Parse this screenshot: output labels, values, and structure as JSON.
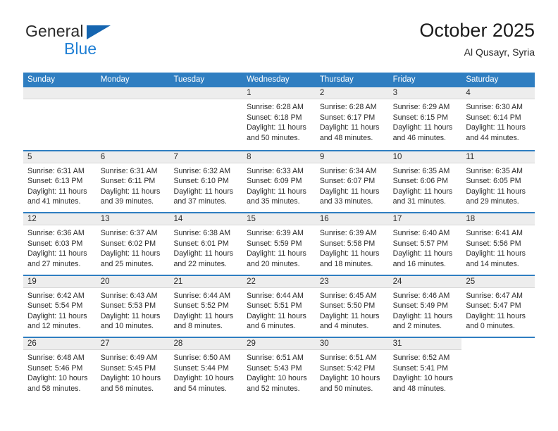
{
  "brand": {
    "name_part1": "General",
    "name_part2": "Blue",
    "triangle_color": "#1565b0",
    "blue_color": "#1f7fd4"
  },
  "header": {
    "title": "October 2025",
    "subtitle": "Al Qusayr, Syria"
  },
  "theme": {
    "header_blue": "#2f7ec1",
    "daynum_strip": "#ededed",
    "text": "#2a2a2a"
  },
  "weekdays": [
    "Sunday",
    "Monday",
    "Tuesday",
    "Wednesday",
    "Thursday",
    "Friday",
    "Saturday"
  ],
  "weeks": [
    [
      {
        "blank": true
      },
      {
        "blank": true
      },
      {
        "blank": true
      },
      {
        "day": "1",
        "sunrise": "Sunrise: 6:28 AM",
        "sunset": "Sunset: 6:18 PM",
        "daylight1": "Daylight: 11 hours",
        "daylight2": "and 50 minutes."
      },
      {
        "day": "2",
        "sunrise": "Sunrise: 6:28 AM",
        "sunset": "Sunset: 6:17 PM",
        "daylight1": "Daylight: 11 hours",
        "daylight2": "and 48 minutes."
      },
      {
        "day": "3",
        "sunrise": "Sunrise: 6:29 AM",
        "sunset": "Sunset: 6:15 PM",
        "daylight1": "Daylight: 11 hours",
        "daylight2": "and 46 minutes."
      },
      {
        "day": "4",
        "sunrise": "Sunrise: 6:30 AM",
        "sunset": "Sunset: 6:14 PM",
        "daylight1": "Daylight: 11 hours",
        "daylight2": "and 44 minutes."
      }
    ],
    [
      {
        "day": "5",
        "sunrise": "Sunrise: 6:31 AM",
        "sunset": "Sunset: 6:13 PM",
        "daylight1": "Daylight: 11 hours",
        "daylight2": "and 41 minutes."
      },
      {
        "day": "6",
        "sunrise": "Sunrise: 6:31 AM",
        "sunset": "Sunset: 6:11 PM",
        "daylight1": "Daylight: 11 hours",
        "daylight2": "and 39 minutes."
      },
      {
        "day": "7",
        "sunrise": "Sunrise: 6:32 AM",
        "sunset": "Sunset: 6:10 PM",
        "daylight1": "Daylight: 11 hours",
        "daylight2": "and 37 minutes."
      },
      {
        "day": "8",
        "sunrise": "Sunrise: 6:33 AM",
        "sunset": "Sunset: 6:09 PM",
        "daylight1": "Daylight: 11 hours",
        "daylight2": "and 35 minutes."
      },
      {
        "day": "9",
        "sunrise": "Sunrise: 6:34 AM",
        "sunset": "Sunset: 6:07 PM",
        "daylight1": "Daylight: 11 hours",
        "daylight2": "and 33 minutes."
      },
      {
        "day": "10",
        "sunrise": "Sunrise: 6:35 AM",
        "sunset": "Sunset: 6:06 PM",
        "daylight1": "Daylight: 11 hours",
        "daylight2": "and 31 minutes."
      },
      {
        "day": "11",
        "sunrise": "Sunrise: 6:35 AM",
        "sunset": "Sunset: 6:05 PM",
        "daylight1": "Daylight: 11 hours",
        "daylight2": "and 29 minutes."
      }
    ],
    [
      {
        "day": "12",
        "sunrise": "Sunrise: 6:36 AM",
        "sunset": "Sunset: 6:03 PM",
        "daylight1": "Daylight: 11 hours",
        "daylight2": "and 27 minutes."
      },
      {
        "day": "13",
        "sunrise": "Sunrise: 6:37 AM",
        "sunset": "Sunset: 6:02 PM",
        "daylight1": "Daylight: 11 hours",
        "daylight2": "and 25 minutes."
      },
      {
        "day": "14",
        "sunrise": "Sunrise: 6:38 AM",
        "sunset": "Sunset: 6:01 PM",
        "daylight1": "Daylight: 11 hours",
        "daylight2": "and 22 minutes."
      },
      {
        "day": "15",
        "sunrise": "Sunrise: 6:39 AM",
        "sunset": "Sunset: 5:59 PM",
        "daylight1": "Daylight: 11 hours",
        "daylight2": "and 20 minutes."
      },
      {
        "day": "16",
        "sunrise": "Sunrise: 6:39 AM",
        "sunset": "Sunset: 5:58 PM",
        "daylight1": "Daylight: 11 hours",
        "daylight2": "and 18 minutes."
      },
      {
        "day": "17",
        "sunrise": "Sunrise: 6:40 AM",
        "sunset": "Sunset: 5:57 PM",
        "daylight1": "Daylight: 11 hours",
        "daylight2": "and 16 minutes."
      },
      {
        "day": "18",
        "sunrise": "Sunrise: 6:41 AM",
        "sunset": "Sunset: 5:56 PM",
        "daylight1": "Daylight: 11 hours",
        "daylight2": "and 14 minutes."
      }
    ],
    [
      {
        "day": "19",
        "sunrise": "Sunrise: 6:42 AM",
        "sunset": "Sunset: 5:54 PM",
        "daylight1": "Daylight: 11 hours",
        "daylight2": "and 12 minutes."
      },
      {
        "day": "20",
        "sunrise": "Sunrise: 6:43 AM",
        "sunset": "Sunset: 5:53 PM",
        "daylight1": "Daylight: 11 hours",
        "daylight2": "and 10 minutes."
      },
      {
        "day": "21",
        "sunrise": "Sunrise: 6:44 AM",
        "sunset": "Sunset: 5:52 PM",
        "daylight1": "Daylight: 11 hours",
        "daylight2": "and 8 minutes."
      },
      {
        "day": "22",
        "sunrise": "Sunrise: 6:44 AM",
        "sunset": "Sunset: 5:51 PM",
        "daylight1": "Daylight: 11 hours",
        "daylight2": "and 6 minutes."
      },
      {
        "day": "23",
        "sunrise": "Sunrise: 6:45 AM",
        "sunset": "Sunset: 5:50 PM",
        "daylight1": "Daylight: 11 hours",
        "daylight2": "and 4 minutes."
      },
      {
        "day": "24",
        "sunrise": "Sunrise: 6:46 AM",
        "sunset": "Sunset: 5:49 PM",
        "daylight1": "Daylight: 11 hours",
        "daylight2": "and 2 minutes."
      },
      {
        "day": "25",
        "sunrise": "Sunrise: 6:47 AM",
        "sunset": "Sunset: 5:47 PM",
        "daylight1": "Daylight: 11 hours",
        "daylight2": "and 0 minutes."
      }
    ],
    [
      {
        "day": "26",
        "sunrise": "Sunrise: 6:48 AM",
        "sunset": "Sunset: 5:46 PM",
        "daylight1": "Daylight: 10 hours",
        "daylight2": "and 58 minutes."
      },
      {
        "day": "27",
        "sunrise": "Sunrise: 6:49 AM",
        "sunset": "Sunset: 5:45 PM",
        "daylight1": "Daylight: 10 hours",
        "daylight2": "and 56 minutes."
      },
      {
        "day": "28",
        "sunrise": "Sunrise: 6:50 AM",
        "sunset": "Sunset: 5:44 PM",
        "daylight1": "Daylight: 10 hours",
        "daylight2": "and 54 minutes."
      },
      {
        "day": "29",
        "sunrise": "Sunrise: 6:51 AM",
        "sunset": "Sunset: 5:43 PM",
        "daylight1": "Daylight: 10 hours",
        "daylight2": "and 52 minutes."
      },
      {
        "day": "30",
        "sunrise": "Sunrise: 6:51 AM",
        "sunset": "Sunset: 5:42 PM",
        "daylight1": "Daylight: 10 hours",
        "daylight2": "and 50 minutes."
      },
      {
        "day": "31",
        "sunrise": "Sunrise: 6:52 AM",
        "sunset": "Sunset: 5:41 PM",
        "daylight1": "Daylight: 10 hours",
        "daylight2": "and 48 minutes."
      },
      {
        "empty": true
      }
    ]
  ]
}
